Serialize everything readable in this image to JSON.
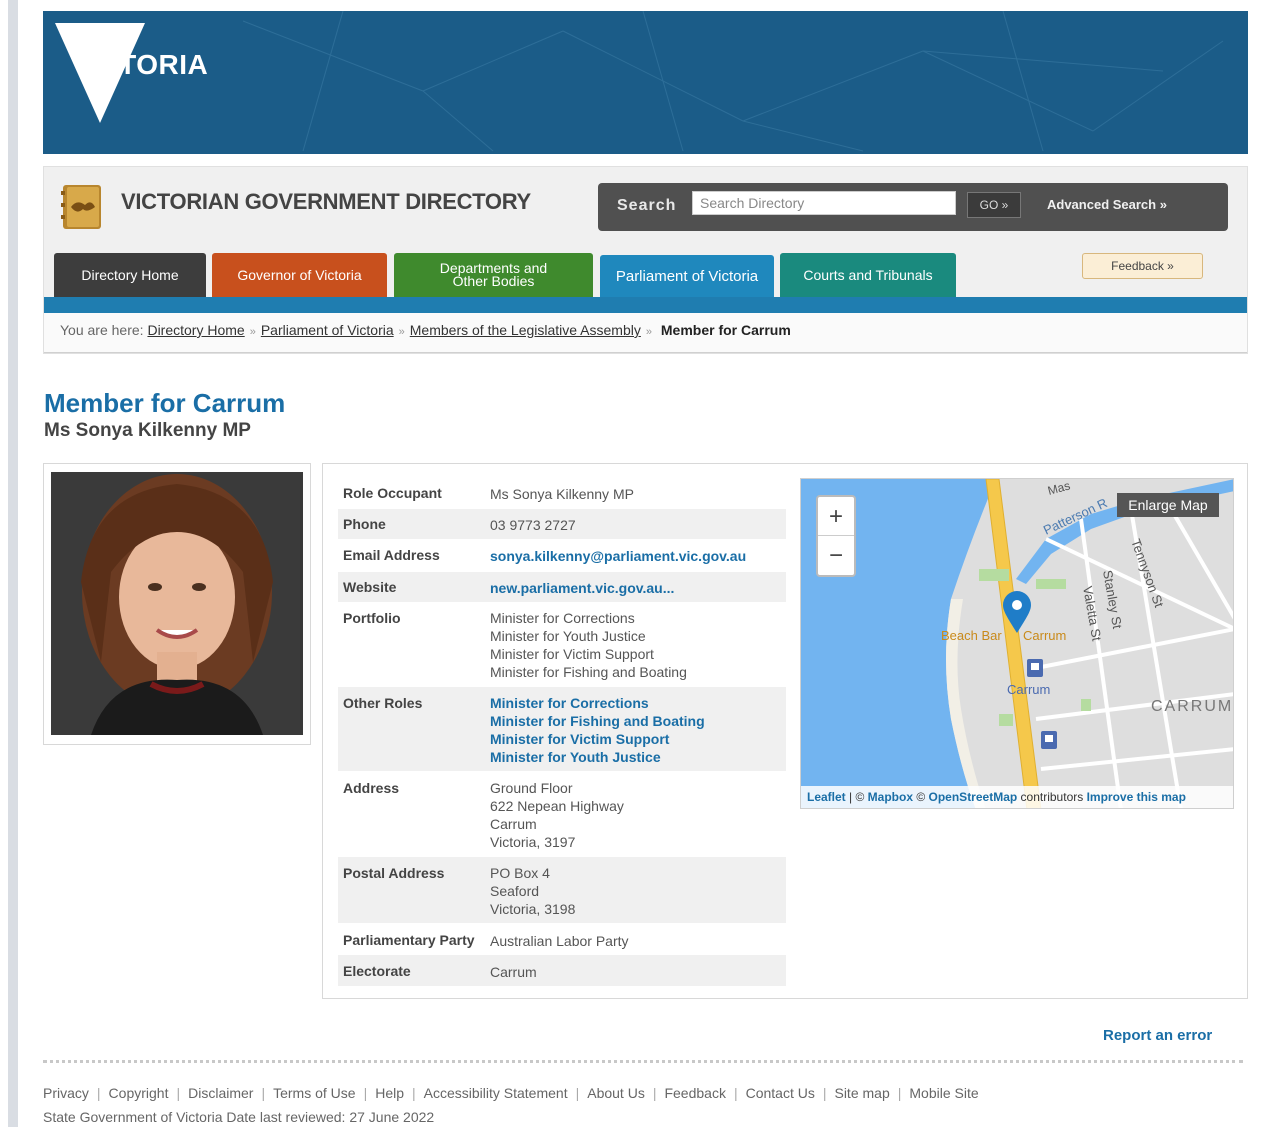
{
  "banner": {
    "logo_text": "VICTORIA"
  },
  "header": {
    "site_title": "VICTORIAN GOVERNMENT DIRECTORY",
    "search_label": "Search",
    "search_placeholder": "Search Directory",
    "go_label": "GO »",
    "advanced_search": "Advanced Search »",
    "feedback": "Feedback »"
  },
  "tabs": [
    {
      "label": "Directory Home"
    },
    {
      "label": "Governor of Victoria"
    },
    {
      "label": "Departments and Other Bodies"
    },
    {
      "label": "Parliament of Victoria"
    },
    {
      "label": "Courts and Tribunals"
    }
  ],
  "breadcrumb": {
    "prefix": "You are here:",
    "items": [
      "Directory Home",
      "Parliament of Victoria",
      "Members of the Legislative Assembly"
    ],
    "current": "Member for Carrum"
  },
  "page": {
    "title": "Member for Carrum",
    "subtitle": "Ms Sonya Kilkenny MP"
  },
  "details": {
    "role_occupant": {
      "label": "Role Occupant",
      "value": "Ms Sonya Kilkenny MP"
    },
    "phone": {
      "label": "Phone",
      "value": "03 9773 2727"
    },
    "email": {
      "label": "Email Address",
      "value": "sonya.kilkenny@parliament.vic.gov.au"
    },
    "website": {
      "label": "Website",
      "value": "new.parliament.vic.gov.au..."
    },
    "portfolio": {
      "label": "Portfolio",
      "values": [
        "Minister for Corrections",
        "Minister for Youth Justice",
        "Minister for Victim Support",
        "Minister for Fishing and Boating"
      ]
    },
    "other_roles": {
      "label": "Other Roles",
      "values": [
        "Minister for Corrections",
        "Minister for Fishing and Boating",
        "Minister for Victim Support",
        "Minister for Youth Justice"
      ]
    },
    "address": {
      "label": "Address",
      "values": [
        "Ground Floor",
        "622 Nepean Highway",
        "Carrum",
        "Victoria, 3197"
      ]
    },
    "postal": {
      "label": "Postal Address",
      "values": [
        "PO Box 4",
        "Seaford",
        "Victoria, 3198"
      ]
    },
    "party": {
      "label": "Parliamentary Party",
      "value": "Australian Labor Party"
    },
    "electorate": {
      "label": "Electorate",
      "value": "Carrum"
    }
  },
  "map": {
    "zoom_in": "+",
    "zoom_out": "−",
    "enlarge": "Enlarge Map",
    "labels": {
      "patterson": "Patterson R",
      "mascot": "Mas",
      "tennyson": "Tennyson St",
      "stanley": "Stanley St",
      "valetta": "Valetta St",
      "beach_bar": "Beach Bar",
      "carrum_poi": "Carrum",
      "carrum_station": "Carrum",
      "carrum_suburb": "CARRUM"
    },
    "attribution": {
      "leaflet": "Leaflet",
      "sep1": " | © ",
      "mapbox": "Mapbox",
      "sep2": " © ",
      "osm": "OpenStreetMap",
      "contributors": " contributors ",
      "improve": "Improve this map"
    }
  },
  "footer": {
    "report_error": "Report an error",
    "links": [
      "Privacy",
      "Copyright",
      "Disclaimer",
      "Terms of Use",
      "Help",
      "Accessibility Statement",
      "About Us",
      "Feedback",
      "Contact Us",
      "Site map",
      "Mobile Site"
    ],
    "note": "State Government of Victoria  Date last reviewed: 27 June 2022"
  },
  "colors": {
    "banner": "#1b5c88",
    "accent_blue": "#1a6ea6",
    "tab_home": "#3d3d3d",
    "tab_gov": "#c8501d",
    "tab_dept": "#3f8a2d",
    "tab_parl": "#1f88bd",
    "tab_courts": "#1a8a7e"
  }
}
